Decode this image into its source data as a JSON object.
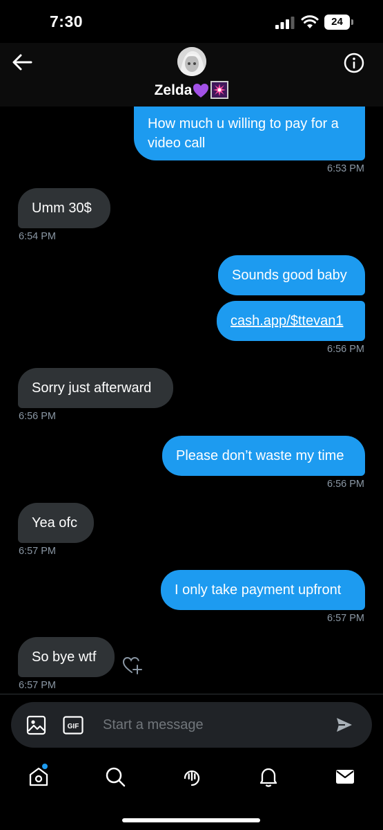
{
  "status_bar": {
    "time": "7:30",
    "battery": "24"
  },
  "header": {
    "contact_name": "Zelda",
    "heart_emoji": "💜",
    "spark_emoji": "💥"
  },
  "messages": [
    {
      "direction": "out",
      "text": "How much u willing to pay for a video call",
      "time": "6:53 PM"
    },
    {
      "direction": "in",
      "text": "Umm 30$",
      "time": "6:54 PM"
    },
    {
      "direction": "out",
      "text": "Sounds good baby",
      "time": ""
    },
    {
      "direction": "out",
      "text": "cash.app/$ttevan1",
      "time": "6:56 PM",
      "is_link": true
    },
    {
      "direction": "in",
      "text": "Sorry just afterward",
      "time": "6:56 PM"
    },
    {
      "direction": "out",
      "text": "Please don’t waste my time",
      "time": "6:56 PM"
    },
    {
      "direction": "in",
      "text": "Yea ofc",
      "time": "6:57 PM"
    },
    {
      "direction": "out",
      "text": "I only take payment upfront",
      "time": "6:57 PM"
    },
    {
      "direction": "in",
      "text": "So bye wtf",
      "time": "6:57 PM"
    }
  ],
  "composer": {
    "placeholder": "Start a message",
    "gif_label": "GIF"
  },
  "nav": {
    "icons": [
      "home-icon",
      "search-icon",
      "spaces-icon",
      "notifications-icon",
      "messages-icon"
    ],
    "home_has_badge": true
  },
  "colors": {
    "accent": "#1d9bf0",
    "incoming_bubble": "#2f3336",
    "background": "#000000",
    "muted_text": "#8b98a5"
  }
}
